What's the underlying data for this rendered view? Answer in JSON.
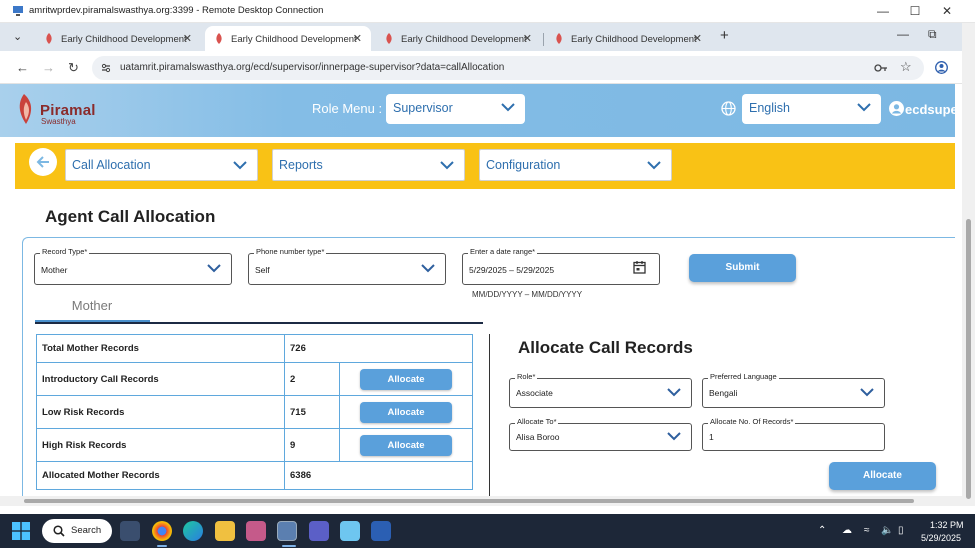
{
  "rdp": {
    "title": "amritwprdev.piramalswasthya.org:3399 - Remote Desktop Connection"
  },
  "browser": {
    "tabs": [
      {
        "label": "Early Childhood Development",
        "active": false
      },
      {
        "label": "Early Childhood Development",
        "active": true
      },
      {
        "label": "Early Childhood Development",
        "active": false
      },
      {
        "label": "Early Childhood Development",
        "active": false
      }
    ],
    "url": "uatamrit.piramalswasthya.org/ecd/supervisor/innerpage-supervisor?data=callAllocation"
  },
  "header": {
    "logo_name": "Piramal",
    "logo_sub": "Swasthya",
    "role_menu_label": "Role Menu :",
    "role_value": "Supervisor",
    "language_value": "English",
    "user_name": "ecdsupe"
  },
  "nav": {
    "call_allocation": "Call Allocation",
    "reports": "Reports",
    "configuration": "Configuration"
  },
  "page": {
    "title": "Agent Call Allocation"
  },
  "filters": {
    "record_type_label": "Record Type",
    "record_type_value": "Mother",
    "phone_type_label": "Phone number type",
    "phone_type_value": "Self",
    "date_range_label": "Enter a date range",
    "date_range_value": "5/29/2025 – 5/29/2025",
    "date_hint": "MM/DD/YYYY – MM/DD/YYYY",
    "submit_label": "Submit"
  },
  "tabs": {
    "mother": "Mother"
  },
  "records": {
    "rows": [
      {
        "label": "Total Mother Records",
        "value": "726",
        "has_button": false
      },
      {
        "label": "Introductory Call Records",
        "value": "2",
        "has_button": true
      },
      {
        "label": "Low Risk Records",
        "value": "715",
        "has_button": true
      },
      {
        "label": "High Risk Records",
        "value": "9",
        "has_button": true
      },
      {
        "label": "Allocated Mother Records",
        "value": "6386",
        "has_button": false
      }
    ],
    "allocate_label": "Allocate"
  },
  "allocate_panel": {
    "title": "Allocate Call Records",
    "role_label": "Role",
    "role_value": "Associate",
    "language_label": "Preferred Language",
    "language_value": "Bengali",
    "allocate_to_label": "Allocate To",
    "allocate_to_value": "Alisa Boroo",
    "count_label": "Allocate No. Of Records",
    "count_value": "1",
    "button_label": "Allocate"
  },
  "taskbar": {
    "search_label": "Search",
    "time": "1:32 PM",
    "date": "5/29/2025"
  },
  "colors": {
    "header_blue": "#7cb8e3",
    "nav_yellow": "#f9c215",
    "button_blue": "#5aa0db",
    "link_blue": "#2e6fae",
    "taskbar": "#1d2738"
  }
}
